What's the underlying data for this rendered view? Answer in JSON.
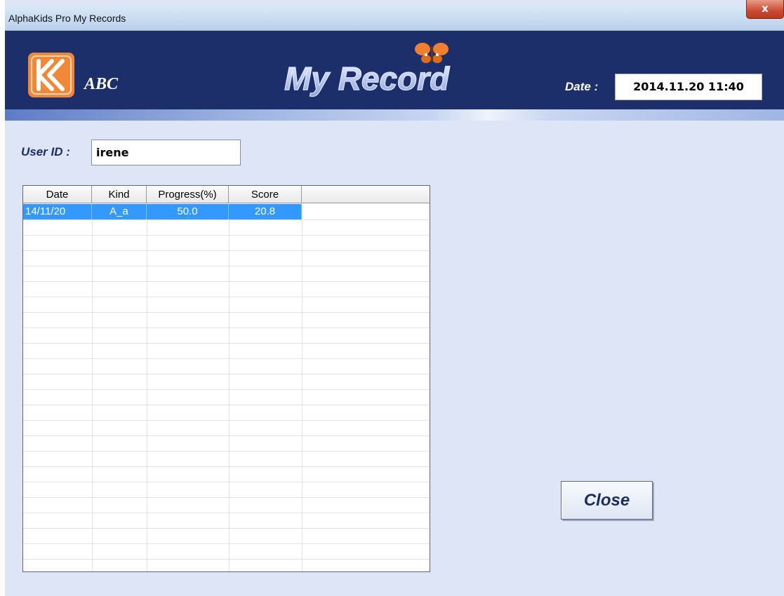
{
  "window": {
    "title": "AlphaKids Pro My Records",
    "close_glyph": "x"
  },
  "banner": {
    "brand_text": "ABC",
    "title": "My Record",
    "date_label": "Date :",
    "date_value": "2014.11.20 11:40",
    "colors": {
      "banner_bg": "#1c2f6a",
      "logo_orange": "#f0883a"
    }
  },
  "user": {
    "label": "User ID :",
    "value": "irene"
  },
  "grid": {
    "columns": [
      "Date",
      "Kind",
      "Progress(%)",
      "Score"
    ],
    "rows": [
      {
        "date": "14/11/20",
        "kind": "A_a",
        "progress": "50.0",
        "score": "20.8"
      }
    ],
    "selected_row_color": "#3399ff"
  },
  "buttons": {
    "close": "Close"
  }
}
